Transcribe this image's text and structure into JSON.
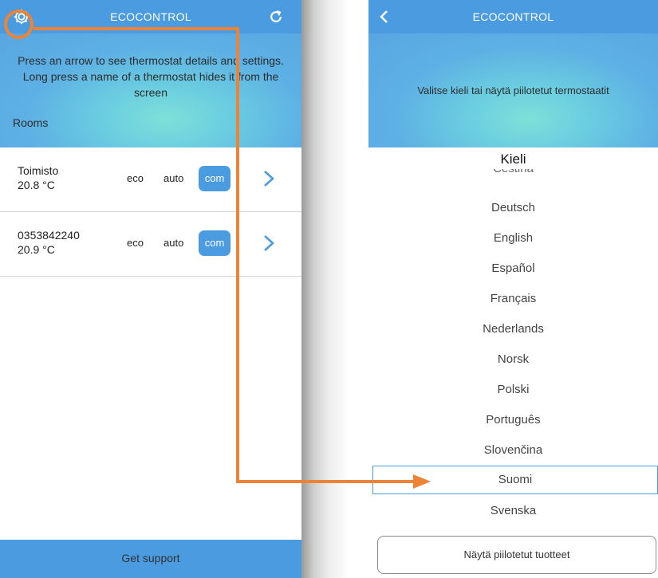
{
  "left": {
    "title": "ECOCONTROL",
    "hero_text": "Press an arrow to see thermostat details and settings. Long press a name of a thermostat hides it from the screen",
    "rooms_label": "Rooms",
    "rooms": [
      {
        "name": "Toimisto",
        "temp": "20.8 °C",
        "eco": "eco",
        "auto": "auto",
        "com": "com"
      },
      {
        "name": "0353842240",
        "temp": "20.9 °C",
        "eco": "eco",
        "auto": "auto",
        "com": "com"
      }
    ],
    "footer": "Get support"
  },
  "right": {
    "title": "ECOCONTROL",
    "hero_text": "Valitse kieli tai näytä piilotetut termostaatit",
    "heading": "Kieli",
    "cut_language": "Čeština",
    "languages": [
      "Deutsch",
      "English",
      "Español",
      "Français",
      "Nederlands",
      "Norsk",
      "Polski",
      "Português",
      "Slovenčina",
      "Suomi",
      "Svenska"
    ],
    "selected_language": "Suomi",
    "show_hidden_button": "Näytä piilotetut tuotteet"
  },
  "colors": {
    "header_blue": "#4a9bdf",
    "annotation_orange": "#ec8336"
  }
}
